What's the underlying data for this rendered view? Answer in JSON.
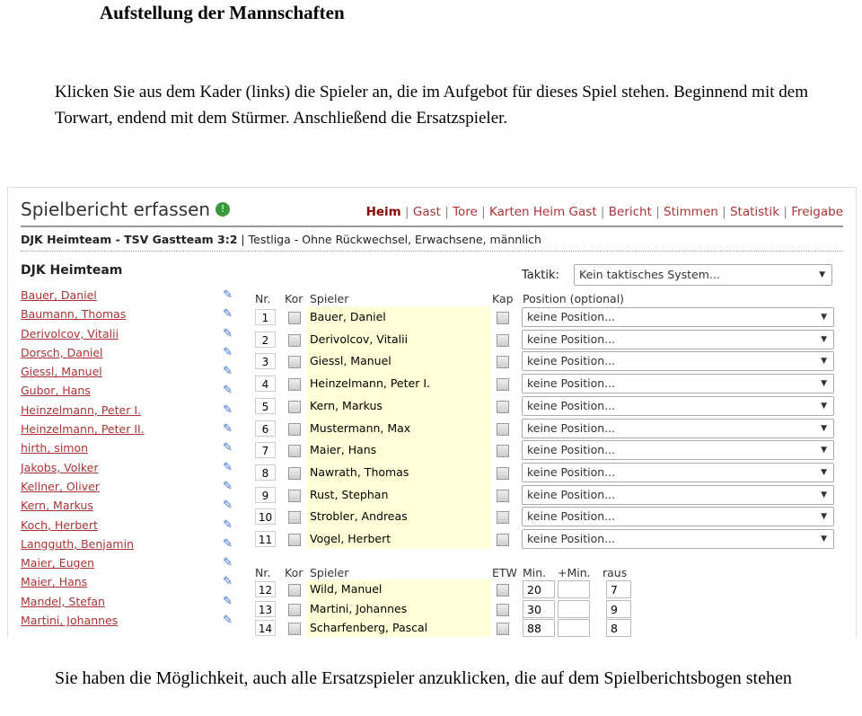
{
  "heading": "Aufstellung der Mannschaften",
  "intro": "Klicken Sie aus dem Kader (links) die Spieler an, die im Aufgebot für dieses Spiel stehen. Beginnend mit dem Torwart, endend mit dem Stürmer. Anschließend die Ersatzspieler.",
  "outro": "Sie haben die Möglichkeit, auch alle Ersatzspieler anzuklicken, die auf dem Spielberichtsbogen stehen",
  "screenshot": {
    "title": "Spielbericht erfassen",
    "nav": [
      "Heim",
      "Gast",
      "Tore",
      "Karten Heim Gast",
      "Bericht",
      "Stimmen",
      "Statistik",
      "Freigabe"
    ],
    "match_bold": "DJK Heimteam - TSV Gastteam 3:2",
    "match_rest": " | Testliga - Ohne Rückwechsel, Erwachsene, männlich",
    "team": "DJK Heimteam",
    "taktik_label": "Taktik:",
    "taktik_value": "Kein taktisches System...",
    "roster": [
      "Bauer, Daniel",
      "Baumann, Thomas",
      "Derivolcov, Vitalii",
      "Dorsch, Daniel",
      "Giessl, Manuel",
      "Gubor, Hans",
      "Heinzelmann, Peter I.",
      "Heinzelmann, Peter II.",
      "hirth, simon",
      "Jakobs, Volker",
      "Kellner, Oliver",
      "Kern, Markus",
      "Koch, Herbert",
      "Langguth, Benjamin",
      "Maier, Eugen",
      "Maier, Hans",
      "Mandel, Stefan",
      "Martini, Johannes"
    ],
    "starters_headers": {
      "nr": "Nr.",
      "kor": "Kor",
      "spieler": "Spieler",
      "kap": "Kap",
      "position": "Position (optional)"
    },
    "position_placeholder": "keine Position...",
    "starters": [
      {
        "nr": "1",
        "name": "Bauer, Daniel"
      },
      {
        "nr": "2",
        "name": "Derivolcov, Vitalii"
      },
      {
        "nr": "3",
        "name": "Giessl, Manuel"
      },
      {
        "nr": "4",
        "name": "Heinzelmann, Peter I."
      },
      {
        "nr": "5",
        "name": "Kern, Markus"
      },
      {
        "nr": "6",
        "name": "Mustermann, Max"
      },
      {
        "nr": "7",
        "name": "Maier, Hans"
      },
      {
        "nr": "8",
        "name": "Nawrath, Thomas"
      },
      {
        "nr": "9",
        "name": "Rust, Stephan"
      },
      {
        "nr": "10",
        "name": "Strobler, Andreas"
      },
      {
        "nr": "11",
        "name": "Vogel, Herbert"
      }
    ],
    "subs_headers": {
      "nr": "Nr.",
      "kor": "Kor",
      "spieler": "Spieler",
      "etw": "ETW",
      "min": "Min.",
      "plusmin": "+Min.",
      "raus": "raus"
    },
    "subs": [
      {
        "nr": "12",
        "name": "Wild, Manuel",
        "min": "20",
        "plusmin": "",
        "raus": "7"
      },
      {
        "nr": "13",
        "name": "Martini, Johannes",
        "min": "30",
        "plusmin": "",
        "raus": "9"
      },
      {
        "nr": "14",
        "name": "Scharfenberg, Pascal",
        "min": "88",
        "plusmin": "",
        "raus": "8"
      }
    ]
  }
}
